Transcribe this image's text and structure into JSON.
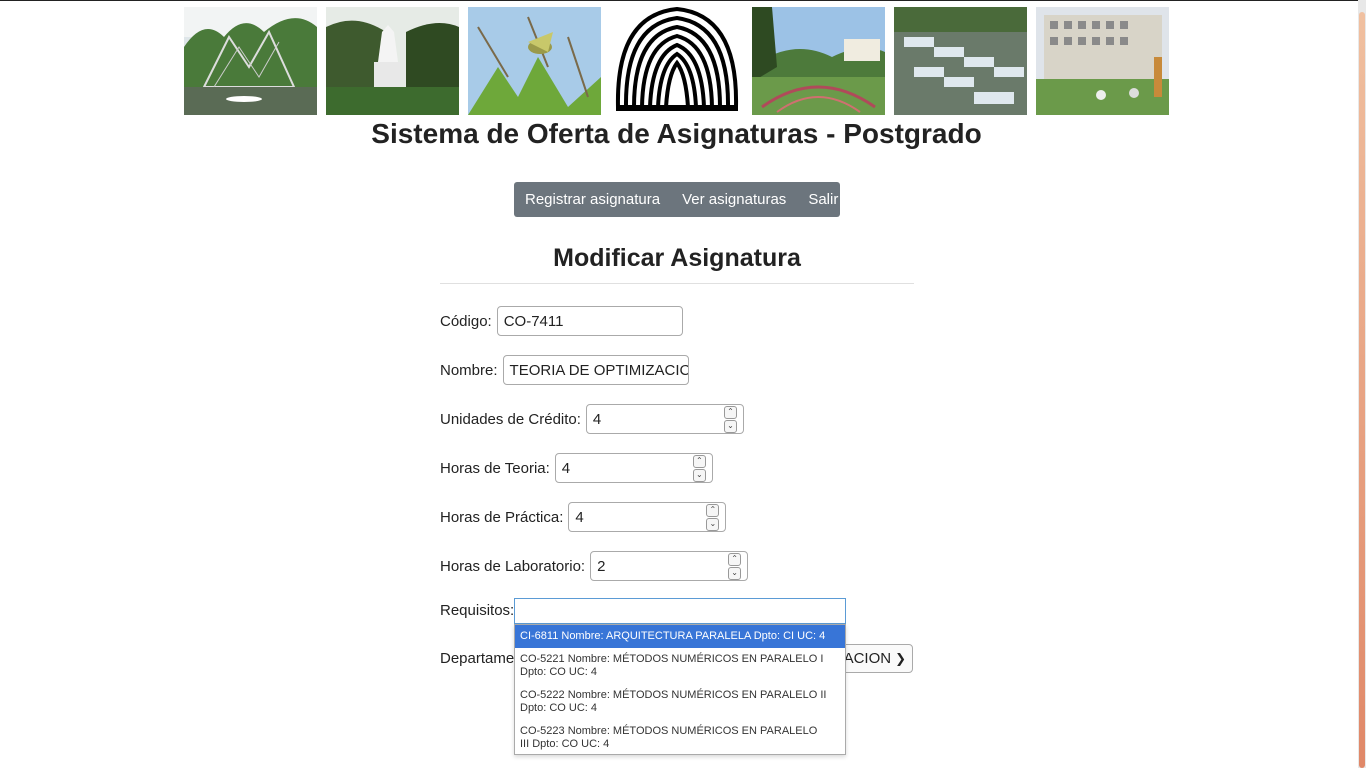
{
  "header": {
    "photos": [
      "sculpture-garden-photo",
      "statue-photo",
      "bird-photo",
      "gardens-photo",
      "fountain-photo",
      "library-building-photo"
    ],
    "logo": "university-logo",
    "title": "Sistema de Oferta de Asignaturas - Postgrado"
  },
  "nav": {
    "items": [
      "Registrar asignatura",
      "Ver asignaturas",
      "Salir"
    ],
    "background": "#6c757d"
  },
  "form": {
    "heading": "Modificar Asignatura",
    "codigo": {
      "label": "Código:",
      "value": "CO-7411"
    },
    "nombre": {
      "label": "Nombre:",
      "value": "TEORIA DE OPTIMIZACIC"
    },
    "creditos": {
      "label": "Unidades de Crédito:",
      "value": "4"
    },
    "teoria": {
      "label": "Horas de Teoria:",
      "value": "4"
    },
    "practica": {
      "label": "Horas de Práctica:",
      "value": "4"
    },
    "laboratorio": {
      "label": "Horas de Laboratorio:",
      "value": "2"
    },
    "requisitos": {
      "label": "Requisitos:",
      "value": "",
      "options": [
        {
          "line1": "CI-6811 Nombre: ARQUITECTURA PARALELA Dpto: CI UC: 4",
          "line2": ""
        },
        {
          "line1": "CO-5221 Nombre: MÉTODOS NUMÉRICOS EN PARALELO I",
          "line2": "Dpto: CO UC: 4"
        },
        {
          "line1": "CO-5222 Nombre: MÉTODOS NUMÉRICOS EN PARALELO II",
          "line2": "Dpto: CO UC: 4"
        },
        {
          "line1": "CO-5223 Nombre: MÉTODOS NUMÉRICOS EN PARALELO",
          "line2": "III Dpto: CO UC: 4"
        }
      ],
      "highlight_color": "#3875d7"
    },
    "departamento": {
      "label": "Departamen",
      "value": "ACION"
    }
  }
}
